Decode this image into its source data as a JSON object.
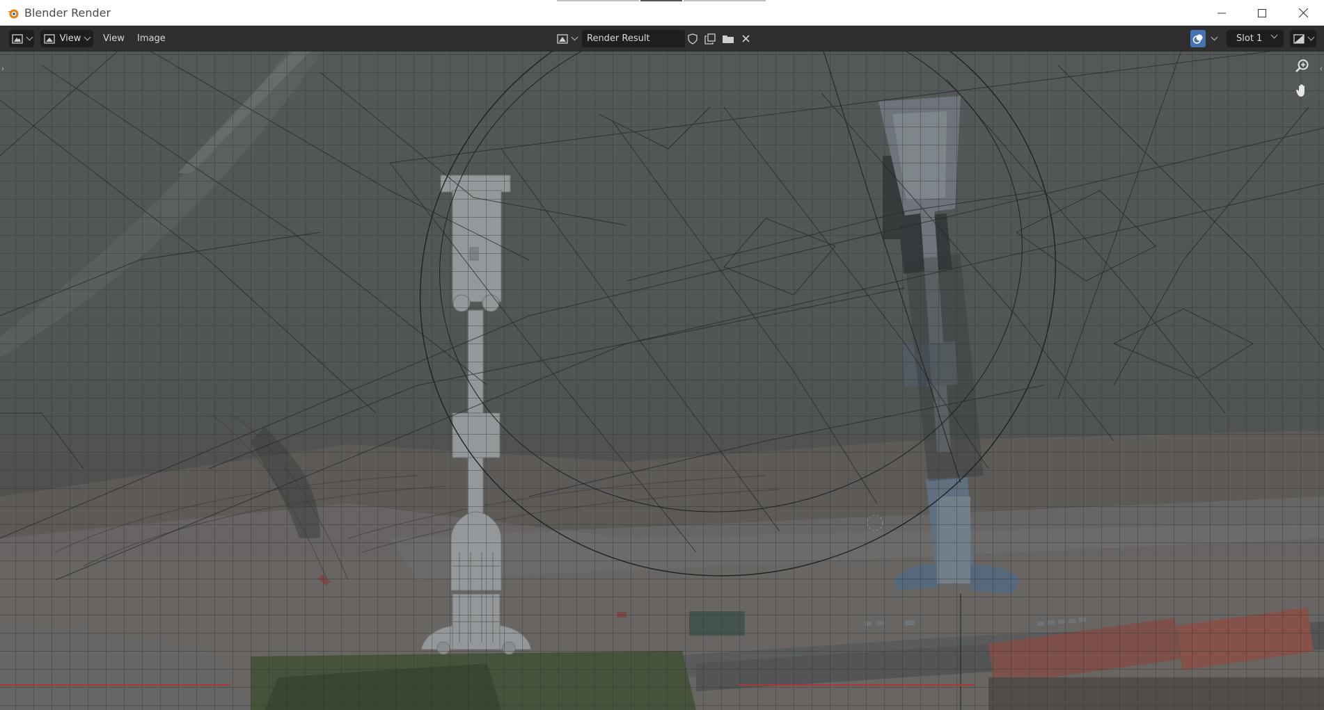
{
  "window": {
    "title": "Blender Render"
  },
  "header": {
    "editor_type_icon": "image-editor-icon",
    "view_mode_icon": "image-view-icon",
    "view_mode_label": "View",
    "menu": {
      "view": "View",
      "image": "Image"
    },
    "image_name": "Render Result",
    "fake_user_icon": "shield-icon",
    "duplicate_icon": "duplicate-icon",
    "open_icon": "folder-icon",
    "close_icon": "close-icon",
    "overlay_icon": "overlay-icon",
    "slot_label": "Slot 1",
    "display_channel_icon": "display-channels-icon"
  },
  "viewport": {
    "zoom_icon": "zoom-icon",
    "pan_icon": "hand-icon"
  },
  "colors": {
    "accent_blue": "#4772b3",
    "header_bg": "#2f2f2f",
    "titlebar_bg": "#ffffff",
    "blender_orange": "#e87d0d"
  }
}
